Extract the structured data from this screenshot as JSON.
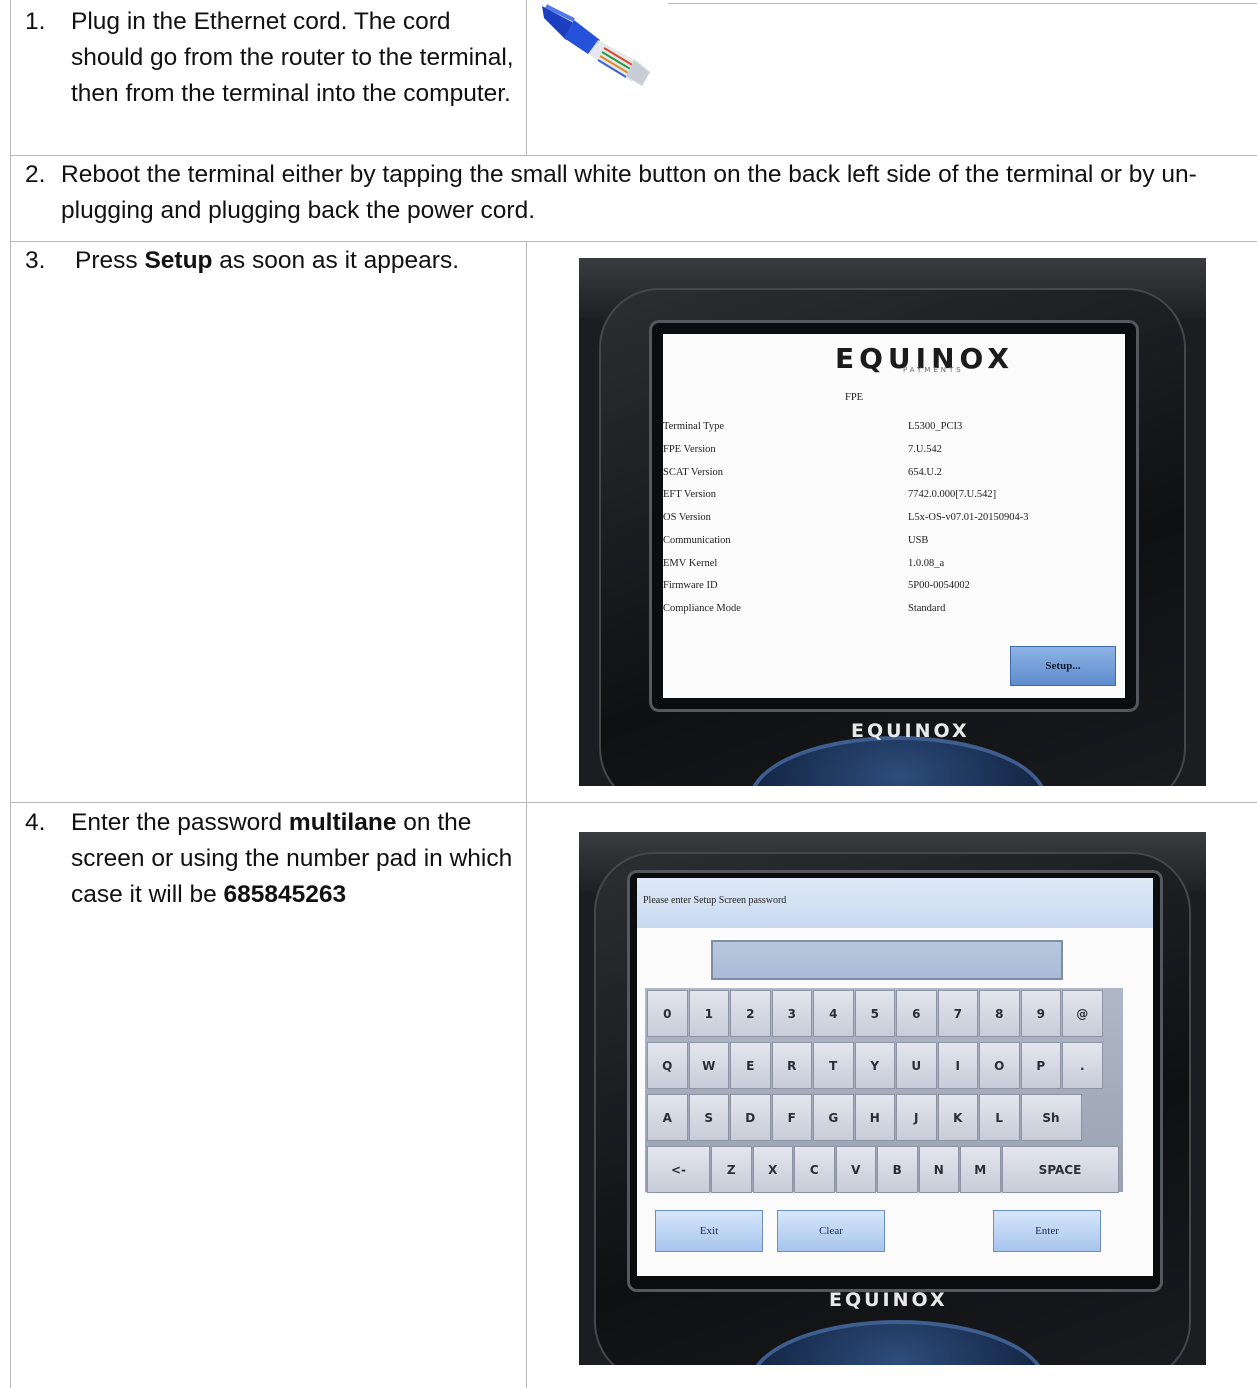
{
  "steps": [
    {
      "number": "1.",
      "text": "Plug in the Ethernet cord. The cord should go from the router to the terminal, then from the terminal into the computer."
    },
    {
      "number": "2.",
      "text": "Reboot the terminal either by tapping the small white button on the back left side of the terminal or by un-plugging and plugging back the power cord."
    },
    {
      "number": "3.",
      "text_before": "Press ",
      "bold": "Setup",
      "text_after": " as soon as it appears."
    },
    {
      "number": "4.",
      "text_before": "Enter the password ",
      "bold": "multilane",
      "text_mid": " on the screen or using the number pad in which case it will be ",
      "bold2": "685845263"
    }
  ],
  "terminal_brand": "EQUINOX",
  "terminal_brand_sub": "PAYMENTS",
  "terminal_foot_brand": "EQUINOX",
  "fpe_screen": {
    "heading": "FPE",
    "rows": [
      {
        "label": "Terminal Type",
        "value": "L5300_PCI3"
      },
      {
        "label": "FPE Version",
        "value": "7.U.542"
      },
      {
        "label": "SCAT Version",
        "value": "654.U.2"
      },
      {
        "label": "EFT Version",
        "value": "7742.0.000[7.U.542]"
      },
      {
        "label": "OS Version",
        "value": "L5x-OS-v07.01-20150904-3"
      },
      {
        "label": "Communication",
        "value": "USB"
      },
      {
        "label": "EMV Kernel",
        "value": "1.0.08_a"
      },
      {
        "label": "Firmware ID",
        "value": "5P00-0054002"
      },
      {
        "label": "Compliance Mode",
        "value": "Standard"
      }
    ],
    "setup_button": "Setup..."
  },
  "password_screen": {
    "prompt": "Please enter Setup Screen password",
    "keyboard": {
      "row1": [
        "0",
        "1",
        "2",
        "3",
        "4",
        "5",
        "6",
        "7",
        "8",
        "9",
        "@"
      ],
      "row2": [
        "Q",
        "W",
        "E",
        "R",
        "T",
        "Y",
        "U",
        "I",
        "O",
        "P",
        "."
      ],
      "row3": [
        "A",
        "S",
        "D",
        "F",
        "G",
        "H",
        "J",
        "K",
        "L",
        "Sh"
      ],
      "row4": [
        "<-",
        "Z",
        "X",
        "C",
        "V",
        "B",
        "N",
        "M",
        "SPACE"
      ]
    },
    "exit_button": "Exit",
    "clear_button": "Clear",
    "enter_button": "Enter"
  }
}
